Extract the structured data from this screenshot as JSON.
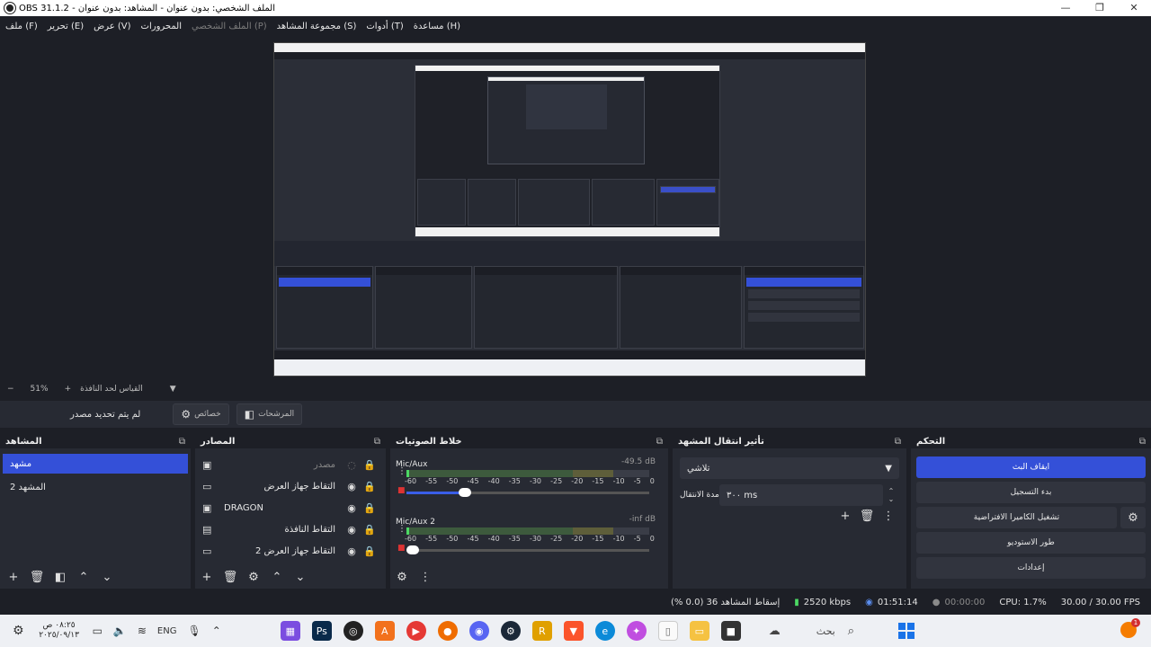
{
  "window": {
    "title": "OBS 31.1.2 - الملف الشخصي: بدون عنوان - المشاهد: بدون عنوان",
    "minimize": "—",
    "maximize": "❐",
    "close": "✕"
  },
  "menu": [
    {
      "label": "ملف (F)",
      "disabled": false
    },
    {
      "label": "تحرير (E)",
      "disabled": false
    },
    {
      "label": "عرض (V)",
      "disabled": false
    },
    {
      "label": "المحرورات",
      "disabled": false
    },
    {
      "label": "الملف الشخصي (P)",
      "disabled": true
    },
    {
      "label": "مجموعة المشاهد (S)",
      "disabled": false
    },
    {
      "label": "أدوات (T)",
      "disabled": false
    },
    {
      "label": "مساعدة (H)",
      "disabled": false
    }
  ],
  "preview_toolbar": {
    "zoom_minus": "−",
    "zoom": "51%",
    "zoom_plus": "+",
    "fit_label": "القياس لحد النافذة",
    "dropdown": "▼"
  },
  "context_bar": {
    "no_source": "لم يتم تحديد مصدر",
    "properties": "خصائص",
    "filters": "المرشحات"
  },
  "scenes": {
    "title": "المشاهد",
    "items": [
      {
        "label": "مشهد",
        "selected": true
      },
      {
        "label": "المشهد 2",
        "selected": false
      }
    ]
  },
  "sources": {
    "title": "المصادر",
    "items": [
      {
        "label": "مصدر",
        "icon": "image-icon",
        "visible": false,
        "dim": true
      },
      {
        "label": "التقاط جهاز العرض",
        "icon": "monitor-icon",
        "visible": true,
        "dim": false
      },
      {
        "label": "DRAGON",
        "icon": "image-icon",
        "visible": true,
        "dim": false
      },
      {
        "label": "التقاط النافذة",
        "icon": "window-icon",
        "visible": true,
        "dim": false
      },
      {
        "label": "التقاط جهاز العرض 2",
        "icon": "monitor-icon",
        "visible": true,
        "dim": false
      }
    ]
  },
  "mixer": {
    "title": "خلاط الصوتيات",
    "scale": [
      "-60",
      "-55",
      "-50",
      "-45",
      "-40",
      "-35",
      "-30",
      "-25",
      "-20",
      "-15",
      "-10",
      "-5",
      "0"
    ],
    "channels": [
      {
        "name": "Mic/Aux",
        "db": "-49.5 dB",
        "volume": 0.24
      },
      {
        "name": "Mic/Aux 2",
        "db": "-inf dB",
        "volume": 0.0
      }
    ]
  },
  "transitions": {
    "title": "تأثير انتقال المشهد",
    "selected": "تلاشي",
    "duration_label": "مدة الانتقال",
    "duration_value": "٣٠٠ ms"
  },
  "controls": {
    "title": "التحكم",
    "stop_stream": "ايقاف البث",
    "start_recording": "بدء التسجيل",
    "virtual_camera": "تشغيل الكاميرا الافتراضية",
    "studio_mode": "طور الاستوديو",
    "settings": "إعدادات"
  },
  "status": {
    "dropped": "إسقاط المشاهد 36 (0.0 %)",
    "bitrate": "2520 kbps",
    "stream_time": "01:51:14",
    "record_time": "00:00:00",
    "cpu": "CPU: 1.7%",
    "fps": "30.00 / 30.00 FPS"
  },
  "taskbar": {
    "time": "٠٨:٢٥ ص",
    "date": "٢٠٢٥/٠٩/١٣",
    "lang": "ENG",
    "search": "بحث",
    "notify_count": "1"
  },
  "colors": {
    "accent": "#3450d8",
    "panel": "#272a33",
    "background": "#1d1f26"
  }
}
